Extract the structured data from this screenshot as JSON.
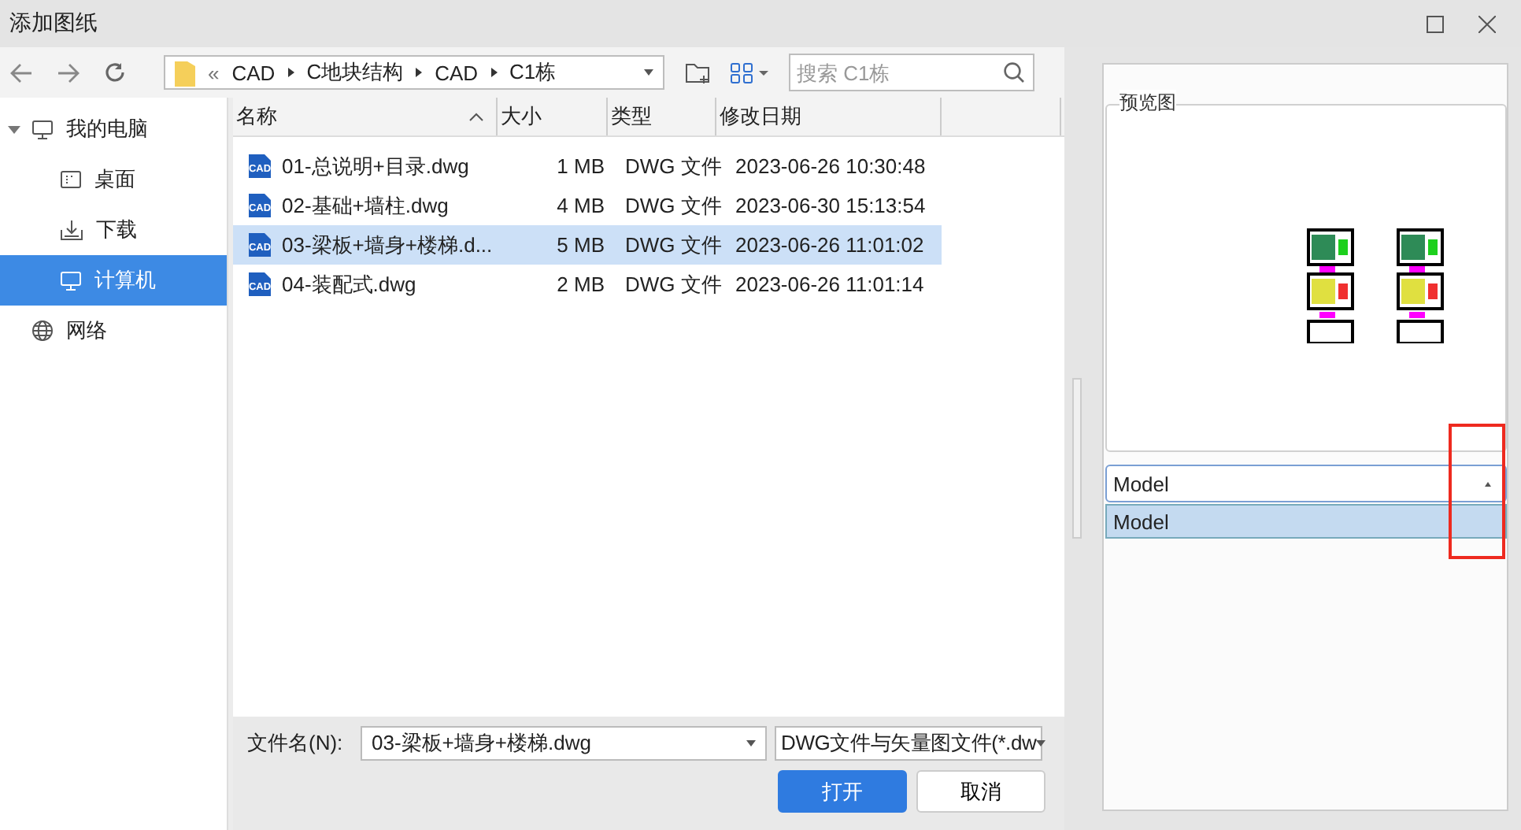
{
  "window": {
    "title": "添加图纸"
  },
  "toolbar": {
    "overflow": "«",
    "breadcrumb": [
      "CAD",
      "C地块结构",
      "CAD",
      "C1栋"
    ],
    "search": {
      "placeholder": "搜索 C1栋"
    }
  },
  "sidebar": {
    "items": [
      {
        "label": "我的电脑",
        "kind": "computer",
        "expanded": true,
        "selected": false,
        "children": [
          {
            "label": "桌面",
            "kind": "desktop",
            "selected": false
          },
          {
            "label": "下载",
            "kind": "download",
            "selected": false
          },
          {
            "label": "计算机",
            "kind": "computer",
            "selected": true
          }
        ]
      },
      {
        "label": "网络",
        "kind": "network",
        "selected": false
      }
    ]
  },
  "table": {
    "columns": [
      {
        "label": "名称",
        "sorted": true
      },
      {
        "label": "大小",
        "sorted": false
      },
      {
        "label": "类型",
        "sorted": false
      },
      {
        "label": "修改日期",
        "sorted": false
      }
    ],
    "rows": [
      {
        "icon_label": "CAD",
        "name": "01-总说明+目录.dwg",
        "size": "1 MB",
        "type": "DWG 文件",
        "modified": "2023-06-26 10:30:48",
        "selected": false
      },
      {
        "icon_label": "CAD",
        "name": "02-基础+墙柱.dwg",
        "size": "4 MB",
        "type": "DWG 文件",
        "modified": "2023-06-30 15:13:54",
        "selected": false
      },
      {
        "icon_label": "CAD",
        "name": "03-梁板+墙身+楼梯.d...",
        "size": "5 MB",
        "type": "DWG 文件",
        "modified": "2023-06-26 11:01:02",
        "selected": true
      },
      {
        "icon_label": "CAD",
        "name": "04-装配式.dwg",
        "size": "2 MB",
        "type": "DWG 文件",
        "modified": "2023-06-26 11:01:14",
        "selected": false
      }
    ]
  },
  "footer": {
    "filename_label": "文件名(N):",
    "filename": "03-梁板+墙身+楼梯.dwg",
    "filter": "DWG文件与矢量图文件(*.dw",
    "buttons": [
      {
        "label": "打开",
        "kind": "primary"
      },
      {
        "label": "取消",
        "kind": "secondary"
      }
    ]
  },
  "preview": {
    "title": "预览图",
    "select": {
      "value": "Model",
      "expanded": true,
      "options": [
        {
          "label": "Model",
          "selected": true
        }
      ]
    }
  }
}
